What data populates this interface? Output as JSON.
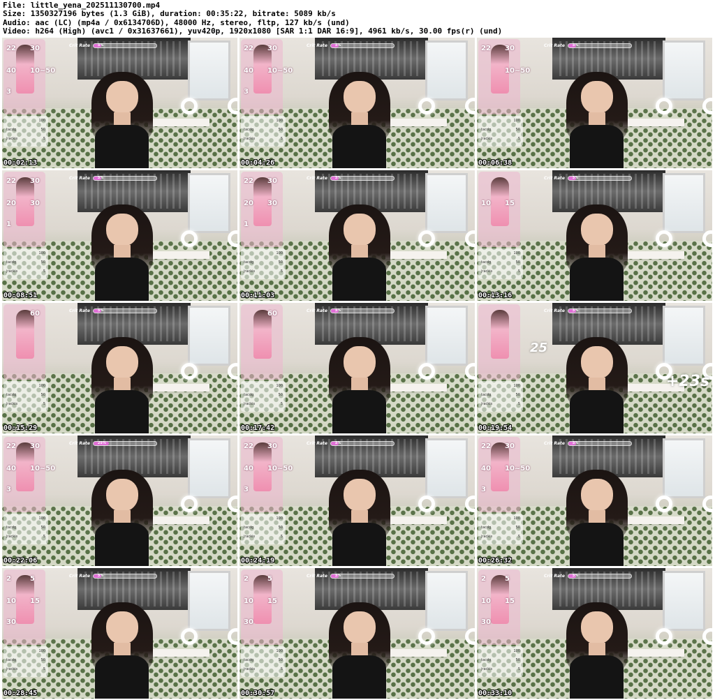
{
  "header": {
    "file": "File: little_yena_202511130700.mp4",
    "size": "Size: 1350327196 bytes (1.3 GiB), duration: 00:35:22, bitrate: 5089 kb/s",
    "audio": "Audio: aac (LC) (mp4a / 0x6134706D), 48000 Hz, stereo, fltp, 127 kb/s (und)",
    "video": "Video: h264 (High) (avc1 / 0x31637661), yuv420p, 1920x1080 [SAR 1:1 DAR 16:9], 4961 kb/s, 30.00 fps(r) (und)"
  },
  "overlay": {
    "crit_label": "Crit Rate"
  },
  "thumbnails": [
    {
      "timestamp": "00:02:13",
      "crit_pct": "5%",
      "crit_fill": 0.12,
      "stats": [
        "22",
        "30",
        "40",
        "10~50",
        "3"
      ],
      "extra": ""
    },
    {
      "timestamp": "00:04:26",
      "crit_pct": "5%",
      "crit_fill": 0.12,
      "stats": [
        "22",
        "30",
        "40",
        "10~50",
        "3"
      ],
      "extra": ""
    },
    {
      "timestamp": "00:06:38",
      "crit_pct": "5%",
      "crit_fill": 0.12,
      "stats": [
        "22",
        "30",
        "",
        "10~50",
        ""
      ],
      "extra": ""
    },
    {
      "timestamp": "00:08:51",
      "crit_pct": "5%",
      "crit_fill": 0.12,
      "stats": [
        "22",
        "30",
        "20",
        "30",
        "1"
      ],
      "extra": ""
    },
    {
      "timestamp": "00:11:03",
      "crit_pct": "5%",
      "crit_fill": 0.12,
      "stats": [
        "22",
        "30",
        "20",
        "30",
        "1"
      ],
      "extra": ""
    },
    {
      "timestamp": "00:13:16",
      "crit_pct": "5%",
      "crit_fill": 0.12,
      "stats": [
        "",
        "",
        "10",
        "15",
        ""
      ],
      "extra": ""
    },
    {
      "timestamp": "00:15:29",
      "crit_pct": "5%",
      "crit_fill": 0.12,
      "stats": [
        "",
        "60",
        "",
        "",
        ""
      ],
      "extra": ""
    },
    {
      "timestamp": "00:17:42",
      "crit_pct": "5%",
      "crit_fill": 0.12,
      "stats": [
        "",
        "60",
        "",
        "",
        ""
      ],
      "extra": ""
    },
    {
      "timestamp": "00:19:54",
      "crit_pct": "5%",
      "crit_fill": 0.12,
      "stats": [
        "",
        "",
        "",
        "",
        ""
      ],
      "extra": "25"
    },
    {
      "timestamp": "00:22:06",
      "crit_pct": "25%",
      "crit_fill": 0.25,
      "stats": [
        "22",
        "30",
        "40",
        "10~50",
        "3"
      ],
      "extra": ""
    },
    {
      "timestamp": "00:24:19",
      "crit_pct": "5%",
      "crit_fill": 0.12,
      "stats": [
        "22",
        "30",
        "40",
        "10~50",
        "3"
      ],
      "extra": ""
    },
    {
      "timestamp": "00:26:32",
      "crit_pct": "5%",
      "crit_fill": 0.12,
      "stats": [
        "22",
        "30",
        "40",
        "10~50",
        "3"
      ],
      "extra": ""
    },
    {
      "timestamp": "00:28:45",
      "crit_pct": "5%",
      "crit_fill": 0.12,
      "stats": [
        "2",
        "5",
        "10",
        "15",
        "30"
      ],
      "extra": ""
    },
    {
      "timestamp": "00:30:57",
      "crit_pct": "5%",
      "crit_fill": 0.12,
      "stats": [
        "2",
        "5",
        "10",
        "15",
        "30"
      ],
      "extra": ""
    },
    {
      "timestamp": "00:33:10",
      "crit_pct": "5%",
      "crit_fill": 0.12,
      "stats": [
        "2",
        "5",
        "10",
        "15",
        "30"
      ],
      "extra": ""
    }
  ],
  "leaderboard": [
    {
      "name": "",
      "value": "100"
    },
    {
      "name": "tacdg",
      "value": "50"
    },
    {
      "name": "jrackis",
      "value": "5"
    }
  ],
  "big_overlay_text": "+23s"
}
